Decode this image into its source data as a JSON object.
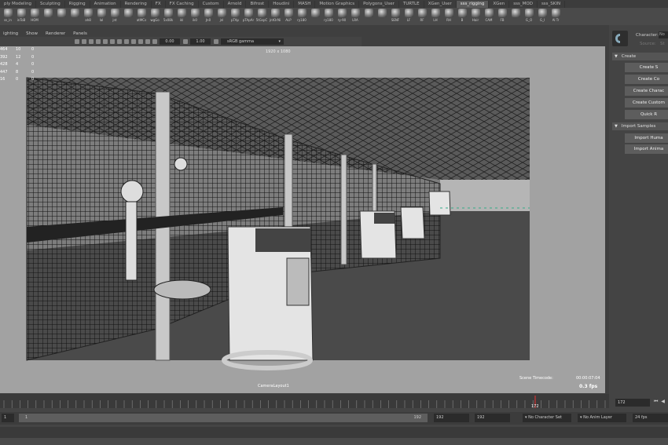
{
  "shelf_tabs": [
    {
      "label": "ply Modeling",
      "active": false
    },
    {
      "label": "Sculpting",
      "active": false
    },
    {
      "label": "Rigging",
      "active": false
    },
    {
      "label": "Animation",
      "active": false
    },
    {
      "label": "Rendering",
      "active": false
    },
    {
      "label": "FX",
      "active": false
    },
    {
      "label": "FX Caching",
      "active": false
    },
    {
      "label": "Custom",
      "active": false
    },
    {
      "label": "Arnold",
      "active": false
    },
    {
      "label": "Bifrost",
      "active": false
    },
    {
      "label": "Houdini",
      "active": false
    },
    {
      "label": "MASH",
      "active": false
    },
    {
      "label": "Motion Graphics",
      "active": false
    },
    {
      "label": "Polygons_User",
      "active": false
    },
    {
      "label": "TURTLE",
      "active": false
    },
    {
      "label": "XGen_User",
      "active": false
    },
    {
      "label": "sss_rigging",
      "active": true
    },
    {
      "label": "XGen",
      "active": false
    },
    {
      "label": "sss_MOD",
      "active": false
    },
    {
      "label": "sss_SKIN",
      "active": false
    }
  ],
  "shelf_buttons": [
    "ss_in",
    "inToB",
    "HOM",
    "",
    "",
    "",
    "ah8",
    "lal",
    "jnt",
    "",
    "atMCs",
    "wgGo",
    "5x08k",
    "ikl",
    "ik0",
    "Jn0",
    "jnl",
    "pTAp",
    "pTApAr",
    "5tGspC",
    "jntOrNi",
    "ALP",
    "ry180",
    "",
    "ry180",
    "ry-90",
    "LRA",
    "",
    "",
    "SENF",
    "LF",
    "RF",
    "LH",
    "RH",
    "B",
    "Hair",
    "CAM",
    "FB",
    "",
    "G_O",
    "G_I",
    "Al Tr"
  ],
  "viewport": {
    "menu": [
      "ighting",
      "Show",
      "Renderer",
      "Panels"
    ],
    "toolbar": {
      "value_a": "0.00",
      "value_b": "1.00",
      "color_space": "sRGB gamma"
    },
    "resolution": "1920 x 1080",
    "hud_rows": [
      [
        "464",
        "10",
        "0"
      ],
      [
        "392",
        "12",
        "0"
      ],
      [
        "428",
        "4",
        "0"
      ],
      [
        "447",
        "8",
        "0"
      ],
      [
        "16",
        "0",
        "0"
      ]
    ],
    "camera": "CameraLayout1",
    "timecode_label": "Scene Timecode:",
    "timecode": "00:00:07:04",
    "fps": "0.3 fps"
  },
  "character_panel": {
    "character_label": "Character:",
    "character_value": "No",
    "source_label": "Source:",
    "source_value": "St",
    "create_section": "Create",
    "create_buttons": [
      "Create S",
      "Create Co",
      "Create Charac",
      "Create Custom",
      "Quick R"
    ],
    "import_section": "Import Samples",
    "import_buttons": [
      "Import Huma",
      "Import Anima"
    ]
  },
  "timeline": {
    "current_frame": "172",
    "current_frame_field": "172",
    "playback_controls": "⏮ ◀",
    "tick_labels": [
      "172"
    ]
  },
  "range": {
    "start": "1",
    "slider_start": "1",
    "slider_end": "192",
    "end": "192",
    "end2": "192",
    "character_set": "No Character Set",
    "anim_layer": "No Anim Layer",
    "fps": "24 fps"
  }
}
